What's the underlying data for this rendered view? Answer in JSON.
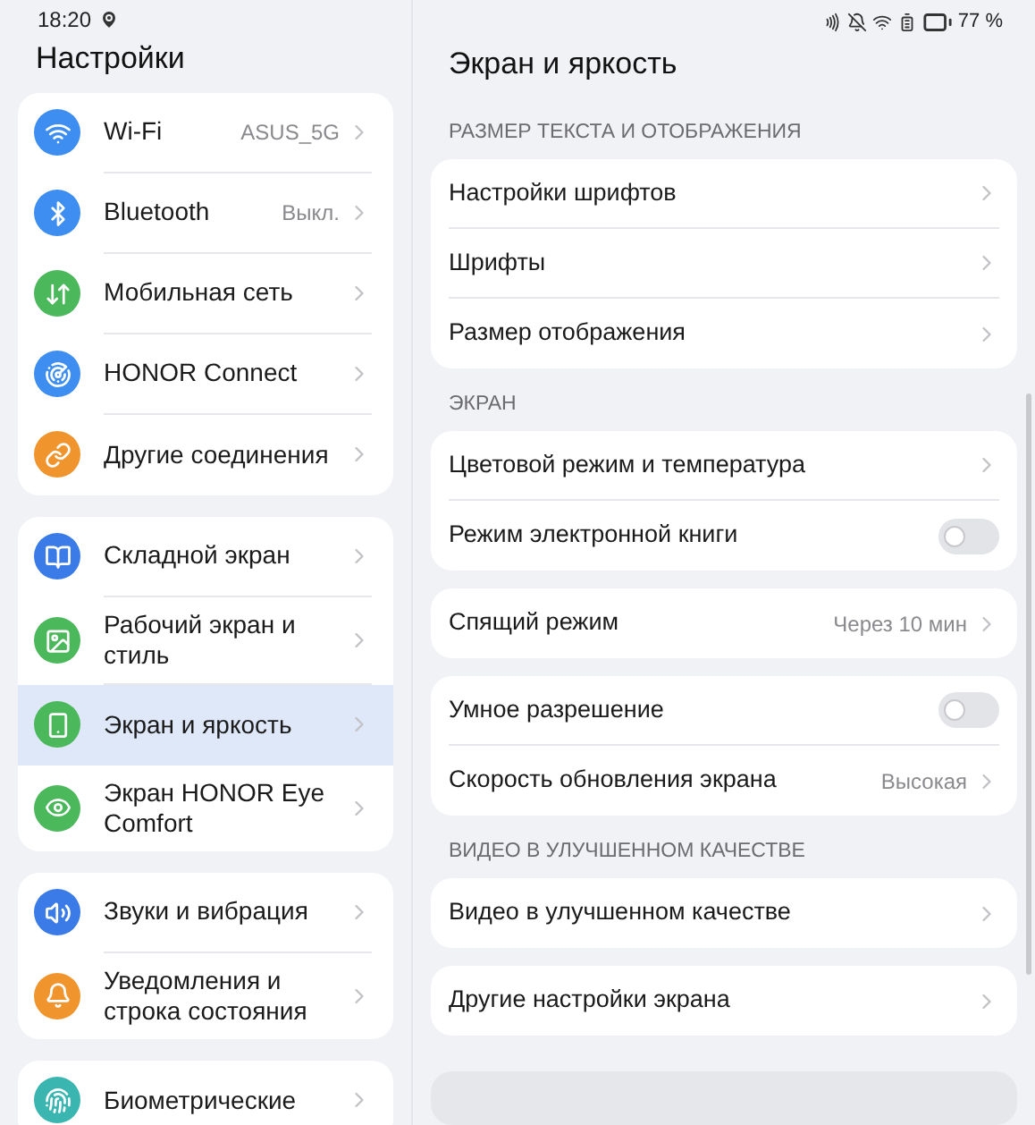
{
  "status_bar": {
    "time": "18:20",
    "battery": "77 %"
  },
  "left": {
    "title": "Настройки",
    "groups": [
      {
        "items": [
          {
            "label": "Wi-Fi",
            "value": "ASUS_5G",
            "selected": false
          },
          {
            "label": "Bluetooth",
            "value": "Выкл.",
            "selected": false
          },
          {
            "label": "Мобильная сеть",
            "selected": false
          },
          {
            "label": "HONOR Connect",
            "selected": false
          },
          {
            "label": "Другие соединения",
            "selected": false
          }
        ]
      },
      {
        "items": [
          {
            "label": "Складной экран",
            "selected": false
          },
          {
            "label": "Рабочий экран и стиль",
            "selected": false
          },
          {
            "label": "Экран и яркость",
            "selected": true
          },
          {
            "label": "Экран HONOR Eye Comfort",
            "selected": false
          }
        ]
      },
      {
        "items": [
          {
            "label": "Звуки и вибрация",
            "selected": false
          },
          {
            "label": "Уведомления и строка состояния",
            "selected": false
          }
        ]
      },
      {
        "items": [
          {
            "label": "Биометрические",
            "selected": false
          }
        ]
      }
    ]
  },
  "right": {
    "title": "Экран и яркость",
    "sections": [
      {
        "heading": "РАЗМЕР ТЕКСТА И ОТОБРАЖЕНИЯ",
        "cards": [
          [
            {
              "kind": "link",
              "label": "Настройки шрифтов"
            },
            {
              "kind": "link",
              "label": "Шрифты"
            },
            {
              "kind": "link",
              "label": "Размер отображения"
            }
          ]
        ]
      },
      {
        "heading": "ЭКРАН",
        "cards": [
          [
            {
              "kind": "link",
              "label": "Цветовой режим и температура"
            },
            {
              "kind": "toggle",
              "label": "Режим электронной книги",
              "on": false
            }
          ],
          [
            {
              "kind": "link",
              "label": "Спящий режим",
              "value": "Через 10 мин"
            }
          ],
          [
            {
              "kind": "toggle",
              "label": "Умное разрешение",
              "on": false
            },
            {
              "kind": "link",
              "label": "Скорость обновления экрана",
              "value": "Высокая"
            }
          ]
        ]
      },
      {
        "heading": "ВИДЕО В УЛУЧШЕННОМ КАЧЕСТВЕ",
        "cards": [
          [
            {
              "kind": "link",
              "label": "Видео в улучшенном качестве"
            }
          ],
          [
            {
              "kind": "link",
              "label": "Другие настройки экрана"
            }
          ]
        ]
      }
    ]
  }
}
